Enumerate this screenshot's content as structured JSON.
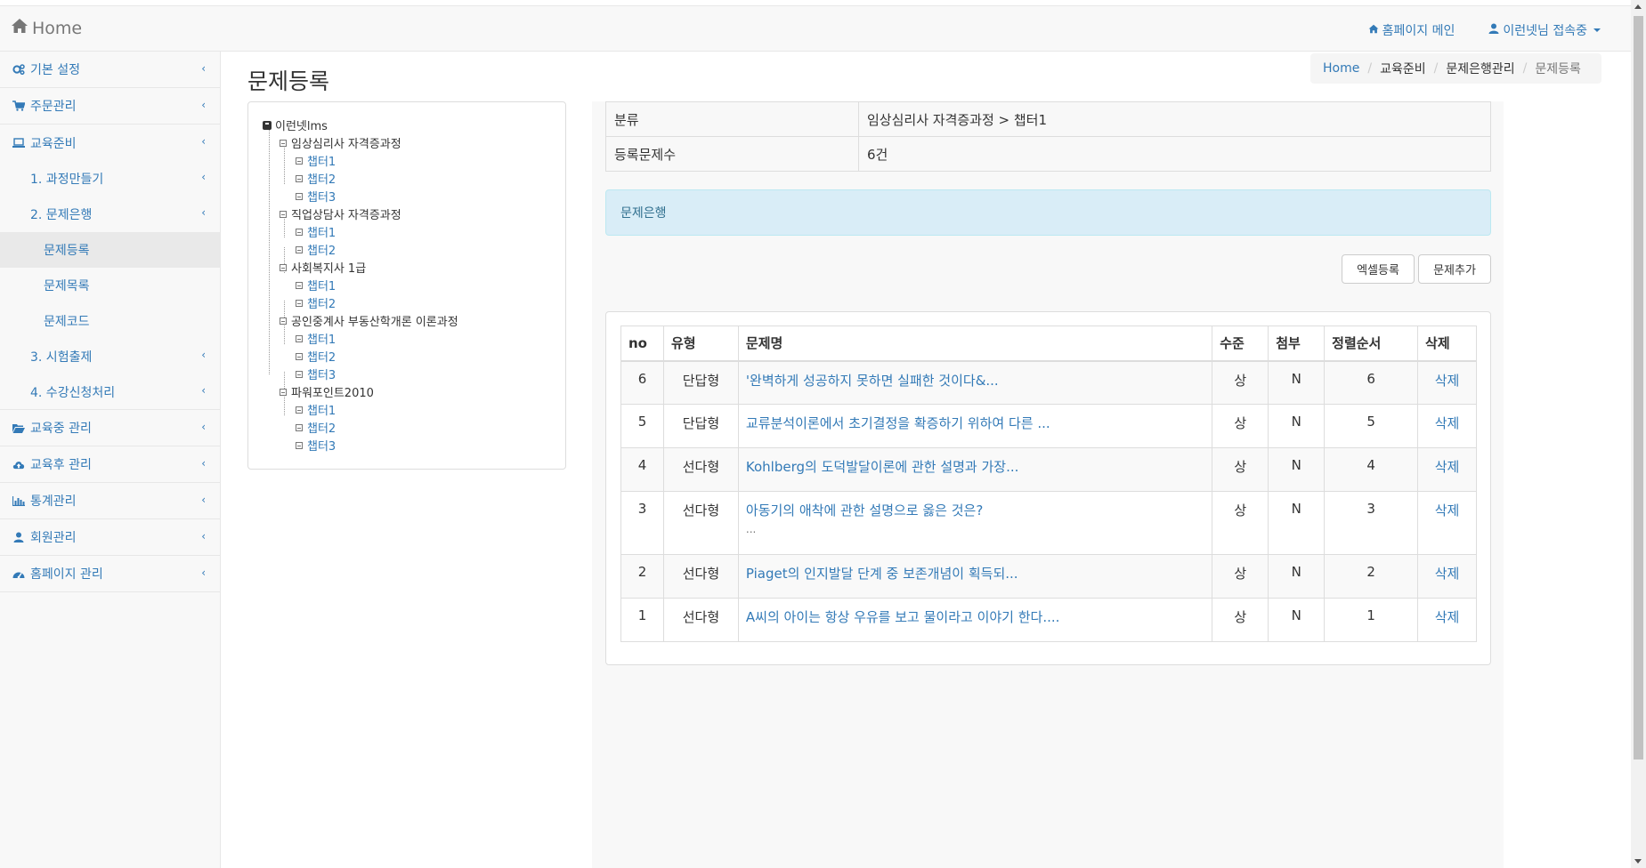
{
  "navbar": {
    "brand": "Home",
    "homepage_link": "홈페이지 메인",
    "user_link": "이런넷님 접속중"
  },
  "sidebar": {
    "items": [
      {
        "label": "기본 설정",
        "icon": "gears-icon"
      },
      {
        "label": "주문관리",
        "icon": "cart-icon"
      },
      {
        "label": "교육준비",
        "icon": "laptop-icon"
      },
      {
        "label": "교육중 관리",
        "icon": "folder-open-icon"
      },
      {
        "label": "교육후 관리",
        "icon": "cloud-upload-icon"
      },
      {
        "label": "통계관리",
        "icon": "bar-chart-icon"
      },
      {
        "label": "회원관리",
        "icon": "user-icon"
      },
      {
        "label": "홈페이지 관리",
        "icon": "dashboard-icon"
      }
    ],
    "sub": {
      "course": "1. 과정만들기",
      "bank": "2. 문제은행",
      "bank_register": "문제등록",
      "bank_list": "문제목록",
      "bank_code": "문제코드",
      "exam": "3. 시험출제",
      "enroll": "4. 수강신청처리"
    }
  },
  "page": {
    "title": "문제등록"
  },
  "breadcrumb": [
    "Home",
    "교육준비",
    "문제은행관리",
    "문제등록"
  ],
  "tree": {
    "root": "이런넷lms",
    "categories": [
      {
        "name": "임상심리사 자격증과정",
        "chapters": [
          "챕터1",
          "챕터2",
          "챕터3"
        ]
      },
      {
        "name": "직업상담사 자격증과정",
        "chapters": [
          "챕터1",
          "챕터2"
        ]
      },
      {
        "name": "사회복지사 1급",
        "chapters": [
          "챕터1",
          "챕터2"
        ]
      },
      {
        "name": "공인중계사 부동산학개론 이론과정",
        "chapters": [
          "챕터1",
          "챕터2",
          "챕터3"
        ]
      },
      {
        "name": "파워포인트2010",
        "chapters": [
          "챕터1",
          "챕터2",
          "챕터3"
        ]
      }
    ]
  },
  "info": {
    "category_label": "분류",
    "category_value": "임상심리사 자격증과정 > 챕터1",
    "count_label": "등록문제수",
    "count_value": "6건"
  },
  "alert": {
    "text": "문제은행"
  },
  "buttons": {
    "excel": "엑셀등록",
    "add": "문제추가"
  },
  "questions": {
    "headers": [
      "no",
      "유형",
      "문제명",
      "수준",
      "첨부",
      "정렬순서",
      "삭제"
    ],
    "rows": [
      {
        "no": "6",
        "type": "단답형",
        "title": "'완벽하게 성공하지 못하면 실패한 것이다&...",
        "extra": "",
        "level": "상",
        "attach": "N",
        "order": "6",
        "delete": "삭제"
      },
      {
        "no": "5",
        "type": "단답형",
        "title": "교류분석이론에서 초기결정을 확증하기 위하여 다른 ...",
        "extra": "",
        "level": "상",
        "attach": "N",
        "order": "5",
        "delete": "삭제"
      },
      {
        "no": "4",
        "type": "선다형",
        "title": "Kohlberg의 도덕발달이론에 관한 설명과 가장...",
        "extra": "",
        "level": "상",
        "attach": "N",
        "order": "4",
        "delete": "삭제"
      },
      {
        "no": "3",
        "type": "선다형",
        "title": "아동기의 애착에 관한 설명으로 옳은 것은?",
        "extra": "...",
        "level": "상",
        "attach": "N",
        "order": "3",
        "delete": "삭제"
      },
      {
        "no": "2",
        "type": "선다형",
        "title": "Piaget의 인지발달 단계 중 보존개념이 획득되...",
        "extra": "",
        "level": "상",
        "attach": "N",
        "order": "2",
        "delete": "삭제"
      },
      {
        "no": "1",
        "type": "선다형",
        "title": "A씨의 아이는 항상 우유를 보고 물이라고 이야기 한다....",
        "extra": "",
        "level": "상",
        "attach": "N",
        "order": "1",
        "delete": "삭제"
      }
    ]
  },
  "colors": {
    "link": "#337ab7",
    "alert_bg": "#d9edf7",
    "sidebar_bg": "#f8f8f8",
    "active_bg": "#e9e9e9"
  }
}
